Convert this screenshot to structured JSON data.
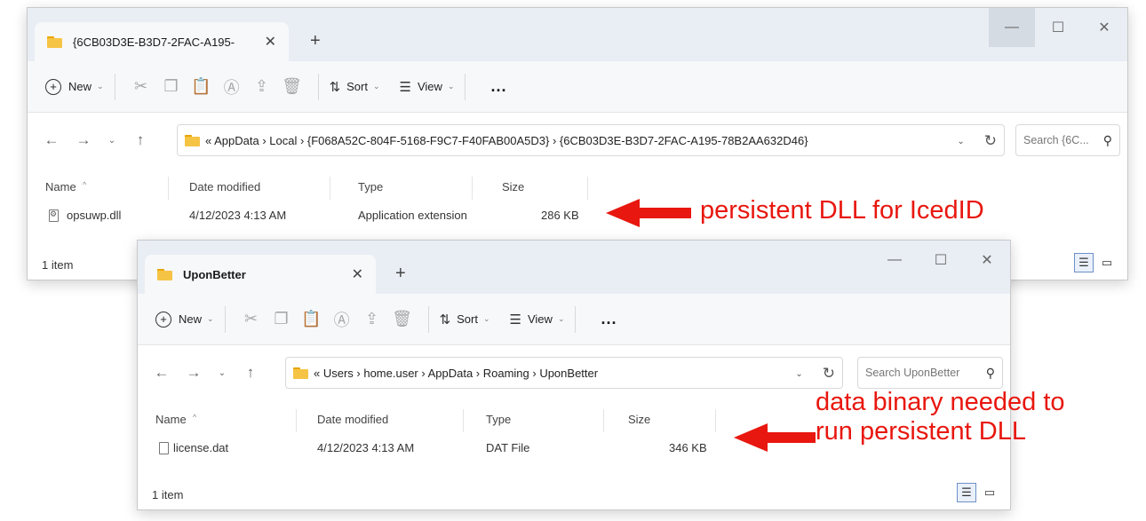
{
  "window1": {
    "tab_title": "{6CB03D3E-B3D7-2FAC-A195-",
    "toolbar": {
      "new_label": "New",
      "sort_label": "Sort",
      "view_label": "View",
      "more_label": "..."
    },
    "breadcrumb": "« AppData › Local › {F068A52C-804F-5168-F9C7-F40FAB00A5D3} › {6CB03D3E-B3D7-2FAC-A195-78B2AA632D46}",
    "search_placeholder": "Search {6C...",
    "columns": {
      "name": "Name",
      "date": "Date modified",
      "type": "Type",
      "size": "Size"
    },
    "files": [
      {
        "name": "opsuwp.dll",
        "date": "4/12/2023 4:13 AM",
        "type": "Application extension",
        "size": "286 KB"
      }
    ],
    "status": "1 item"
  },
  "window2": {
    "tab_title": "UponBetter",
    "toolbar": {
      "new_label": "New",
      "sort_label": "Sort",
      "view_label": "View",
      "more_label": "..."
    },
    "breadcrumb": "« Users › home.user › AppData › Roaming › UponBetter",
    "search_placeholder": "Search UponBetter",
    "columns": {
      "name": "Name",
      "date": "Date modified",
      "type": "Type",
      "size": "Size"
    },
    "files": [
      {
        "name": "license.dat",
        "date": "4/12/2023 4:13 AM",
        "type": "DAT File",
        "size": "346 KB"
      }
    ],
    "status": "1 item"
  },
  "annotations": {
    "first": "persistent DLL for IcedID",
    "second_line1": "data binary needed to",
    "second_line2": "run persistent DLL",
    "color": "#e8170f"
  },
  "icons": [
    "folder-icon",
    "close-icon",
    "plus-icon",
    "minimize-icon",
    "maximize-icon",
    "cut-icon",
    "copy-icon",
    "paste-icon",
    "rename-icon",
    "share-icon",
    "delete-icon",
    "sort-icon",
    "view-icon",
    "back-icon",
    "forward-icon",
    "up-icon",
    "refresh-icon",
    "search-icon",
    "details-view-icon",
    "tiles-view-icon"
  ]
}
